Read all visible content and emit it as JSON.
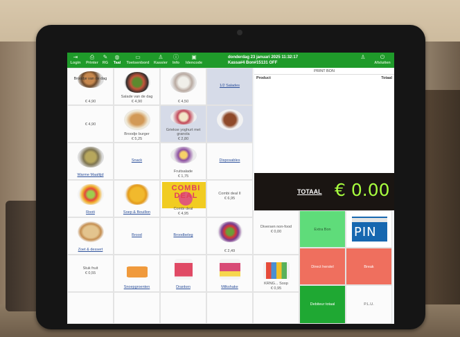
{
  "topbar": {
    "buttons": [
      {
        "label": "Login",
        "icon": "login-icon"
      },
      {
        "label": "Printer",
        "icon": "printer-icon"
      },
      {
        "label": "RG",
        "icon": "wrench-icon"
      },
      {
        "label": "Taal",
        "icon": "globe-icon"
      },
      {
        "label": "Toetsenbord",
        "icon": "keyboard-icon"
      },
      {
        "label": "Kassier",
        "icon": "person-icon"
      },
      {
        "label": "Info",
        "icon": "info-icon"
      },
      {
        "label": "Idencode",
        "icon": "idcard-icon"
      }
    ],
    "datetime": "donderdag 23 januari 2025 11:32:17",
    "register": "Kassa#4 Bon#15131 OFF",
    "afsluiten": "Afsluiten"
  },
  "tiles": [
    {
      "name": "Broodje van de dag",
      "price": "€ 4,90"
    },
    {
      "name": "Salade van de dag",
      "price": "€ 4,90"
    },
    {
      "name": "",
      "price": "€ 4,50"
    },
    {
      "name": "1/2 Salades",
      "price": ""
    },
    {
      "name": "",
      "price": "€ 4,90"
    },
    {
      "name": "Broodje burger",
      "price": "€ 5,25"
    },
    {
      "name": "Griekse yoghurt met granola",
      "price": "€ 2,80"
    },
    {
      "name": "",
      "price": ""
    },
    {
      "name": "Warme Maaltijd",
      "price": ""
    },
    {
      "name": "Snack",
      "price": ""
    },
    {
      "name": "Fruitsalade",
      "price": "€ 1,75"
    },
    {
      "name": "Disposables",
      "price": ""
    },
    {
      "name": "Rooti",
      "price": ""
    },
    {
      "name": "Soep & Bouillon",
      "price": ""
    },
    {
      "name": "Combi deal",
      "price": "€ 4,95"
    },
    {
      "name": "Combi deal II",
      "price": "€ 6,95"
    },
    {
      "name": "Diversen non-food",
      "price": "€ 0,00"
    },
    {
      "name": "Zoet & dessert",
      "price": ""
    },
    {
      "name": "Brood",
      "price": ""
    },
    {
      "name": "Broodbeleg",
      "price": ""
    },
    {
      "name": "",
      "price": "€ 2,49"
    },
    {
      "name": "Stuk fruit",
      "price": "€ 0,55"
    },
    {
      "name": "Snoepgroenten",
      "price": ""
    },
    {
      "name": "Dranken",
      "price": ""
    },
    {
      "name": "Milkshake",
      "price": ""
    },
    {
      "name": "KRNG... Soop",
      "price": "€ 0,95"
    }
  ],
  "combi_word": "COMBI DEAL",
  "receipt": {
    "header": "PRINT BON",
    "col_product": "Product",
    "col_total": "Totaal",
    "totaal_label": "TOTAAL",
    "totaal_value": "€ 0.00"
  },
  "actions": {
    "extra_bon": "Extra Bon",
    "pin": "PIN",
    "direct_herstel": "Direct herstel",
    "break": "Break",
    "debiteur_totaal": "Debiteur totaal",
    "plu": "P.L.U."
  },
  "colors": {
    "topbar": "#1f9a2a",
    "totaal_value": "#a8ff3f",
    "action_green": "#5fdc7a",
    "action_red": "#ef6f5e",
    "pin_blue": "#1667b0"
  }
}
